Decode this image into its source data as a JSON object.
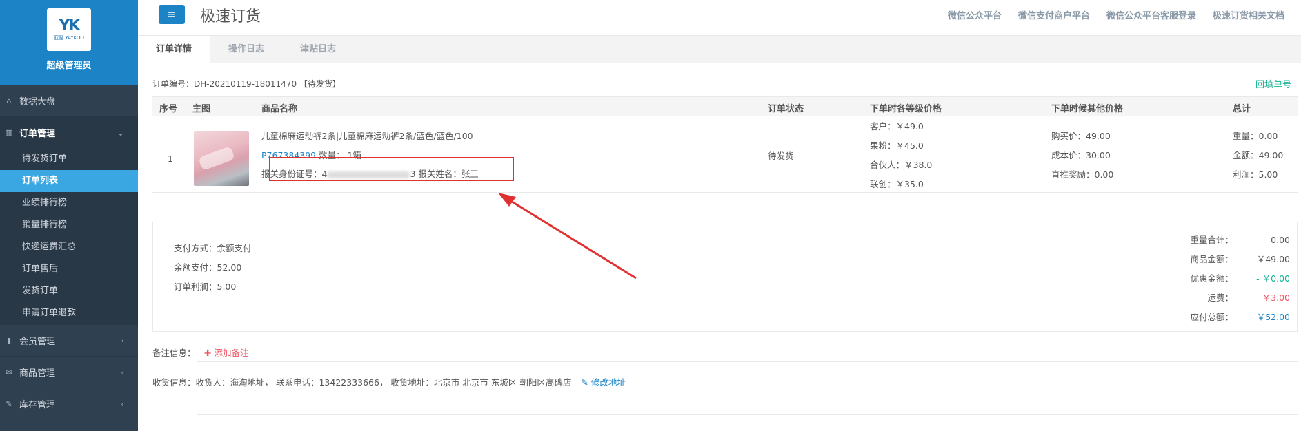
{
  "sidebar": {
    "logo_mark": "YK",
    "logo_sub": "亚酷 YAYKOO",
    "admin_name": "超级管理员",
    "menu": [
      {
        "label": "数据大盘",
        "icon": "home-icon"
      },
      {
        "label": "订单管理",
        "icon": "columns-icon",
        "arrow": "⌄"
      },
      {
        "label": "会员管理",
        "icon": "bar-chart-icon",
        "arrow": "‹"
      },
      {
        "label": "商品管理",
        "icon": "envelope-icon",
        "arrow": "‹"
      },
      {
        "label": "库存管理",
        "icon": "edit-icon",
        "arrow": "‹"
      }
    ],
    "submenu": [
      "待发货订单",
      "订单列表",
      "业绩排行榜",
      "销量排行榜",
      "快递运费汇总",
      "订单售后",
      "发货订单",
      "申请订单退款"
    ]
  },
  "topbar": {
    "title": "极速订货",
    "links": [
      "微信公众平台",
      "微信支付商户平台",
      "微信公众平台客服登录",
      "极速订货相关文档"
    ]
  },
  "tabs": [
    "订单详情",
    "操作日志",
    "津贴日志"
  ],
  "order": {
    "number_line": "订单编号：DH-20210119-18011470 【待发货】",
    "refill_link": "回填单号"
  },
  "table": {
    "headers": [
      "序号",
      "主图",
      "商品名称",
      "订单状态",
      "下单时各等级价格",
      "下单时候其他价格",
      "总计"
    ],
    "row": {
      "index": "1",
      "product_name": "儿童棉麻运动裤2条|儿童棉麻运动裤2条/蓝色/蓝色/100",
      "product_code": "P767384399",
      "quantity": "数量：  1箱",
      "customs_id_label": "报关身份证号：4",
      "customs_id_tail": "3",
      "customs_name": "报关姓名：张三",
      "status": "待发货",
      "level_prices": [
        "客户：￥49.0",
        "果粉：￥45.0",
        "合伙人：￥38.0",
        "联创：￥35.0"
      ],
      "other_prices": [
        "购买价：49.00",
        "成本价：30.00",
        "直推奖励：0.00"
      ],
      "totals": [
        "重量：0.00",
        "金额：49.00",
        "利润：5.00"
      ]
    }
  },
  "summary": {
    "pay_info": [
      "支付方式：余额支付",
      "余额支付：52.00",
      "订单利润：5.00"
    ],
    "totals": [
      {
        "label": "重量合计：",
        "value": "0.00",
        "color": "#555555"
      },
      {
        "label": "商品金额：",
        "value": "￥49.00",
        "color": "#555555"
      },
      {
        "label": "优惠金额：",
        "value": "- ￥0.00",
        "color": "#1ab394"
      },
      {
        "label": "运费：",
        "value": "￥3.00",
        "color": "#ed5565"
      },
      {
        "label": "应付总额：",
        "value": "￥52.00",
        "color": "#1c84c6"
      }
    ]
  },
  "remark": {
    "label": "备注信息：",
    "add_label": "添加备注"
  },
  "address": {
    "text": "收货信息：收货人：海淘地址，  联系电话：13422333666，  收货地址：北京市 北京市 东城区 朝阳区高碑店",
    "edit_label": "修改地址"
  },
  "colors": {
    "sidebar_bg": "#2f4050",
    "brand_blue": "#1c84c6",
    "active_item": "#3aa7e3",
    "annotation_red": "#e03030"
  }
}
